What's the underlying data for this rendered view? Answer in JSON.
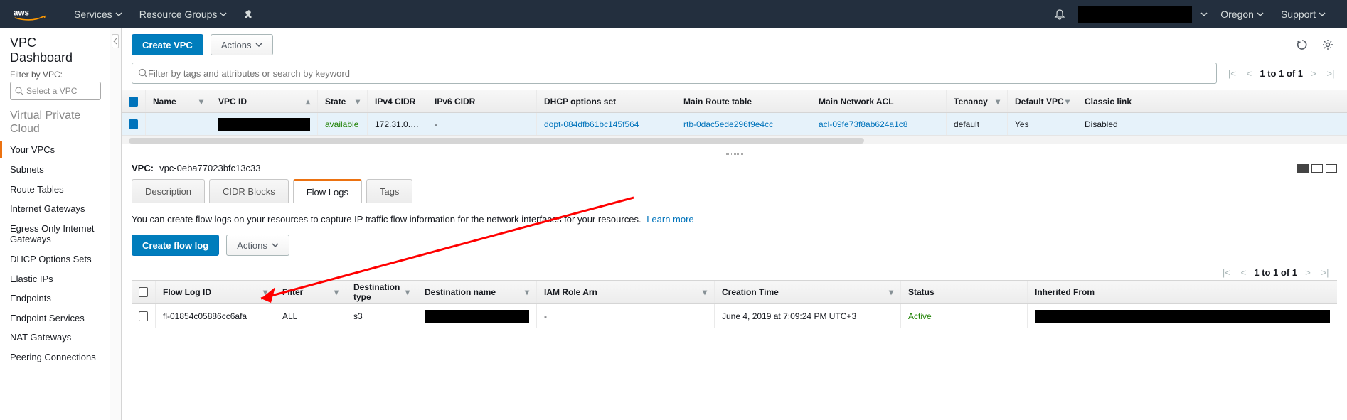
{
  "topnav": {
    "services": "Services",
    "resource_groups": "Resource Groups",
    "region": "Oregon",
    "support": "Support"
  },
  "sidebar": {
    "title": "VPC Dashboard",
    "filter_label": "Filter by VPC:",
    "select_placeholder": "Select a VPC",
    "section1": "Virtual Private Cloud",
    "items": [
      "Your VPCs",
      "Subnets",
      "Route Tables",
      "Internet Gateways",
      "Egress Only Internet Gateways",
      "DHCP Options Sets",
      "Elastic IPs",
      "Endpoints",
      "Endpoint Services",
      "NAT Gateways",
      "Peering Connections"
    ]
  },
  "toolbar": {
    "create": "Create VPC",
    "actions": "Actions"
  },
  "search": {
    "placeholder": "Filter by tags and attributes or search by keyword"
  },
  "pager_top": {
    "range": "1 to 1 of 1"
  },
  "vpc_table": {
    "headers": [
      "Name",
      "VPC ID",
      "State",
      "IPv4 CIDR",
      "IPv6 CIDR",
      "DHCP options set",
      "Main Route table",
      "Main Network ACL",
      "Tenancy",
      "Default VPC",
      "Classic link"
    ],
    "row": {
      "state": "available",
      "ipv4": "172.31.0.…",
      "ipv6": "-",
      "dhcp": "dopt-084dfb61bc145f564",
      "rtb": "rtb-0dac5ede296f9e4cc",
      "acl": "acl-09fe73f8ab624a1c8",
      "tenancy": "default",
      "default_vpc": "Yes",
      "classic": "Disabled"
    }
  },
  "detail": {
    "label": "VPC:",
    "id": "vpc-0eba77023bfc13c33",
    "tabs": [
      "Description",
      "CIDR Blocks",
      "Flow Logs",
      "Tags"
    ],
    "flow_desc": "You can create flow logs on your resources to capture IP traffic flow information for the network interfaces for your resources.",
    "learn_more": "Learn more",
    "create_flow": "Create flow log",
    "actions": "Actions"
  },
  "pager_flow": {
    "range": "1 to 1 of 1"
  },
  "flow_table": {
    "headers": [
      "Flow Log ID",
      "Filter",
      "Destination type",
      "Destination name",
      "IAM Role Arn",
      "Creation Time",
      "Status",
      "Inherited From"
    ],
    "row": {
      "id": "fl-01854c05886cc6afa",
      "filter": "ALL",
      "dest_type": "s3",
      "iam": "-",
      "created": "June 4, 2019 at 7:09:24 PM UTC+3",
      "status": "Active"
    }
  }
}
